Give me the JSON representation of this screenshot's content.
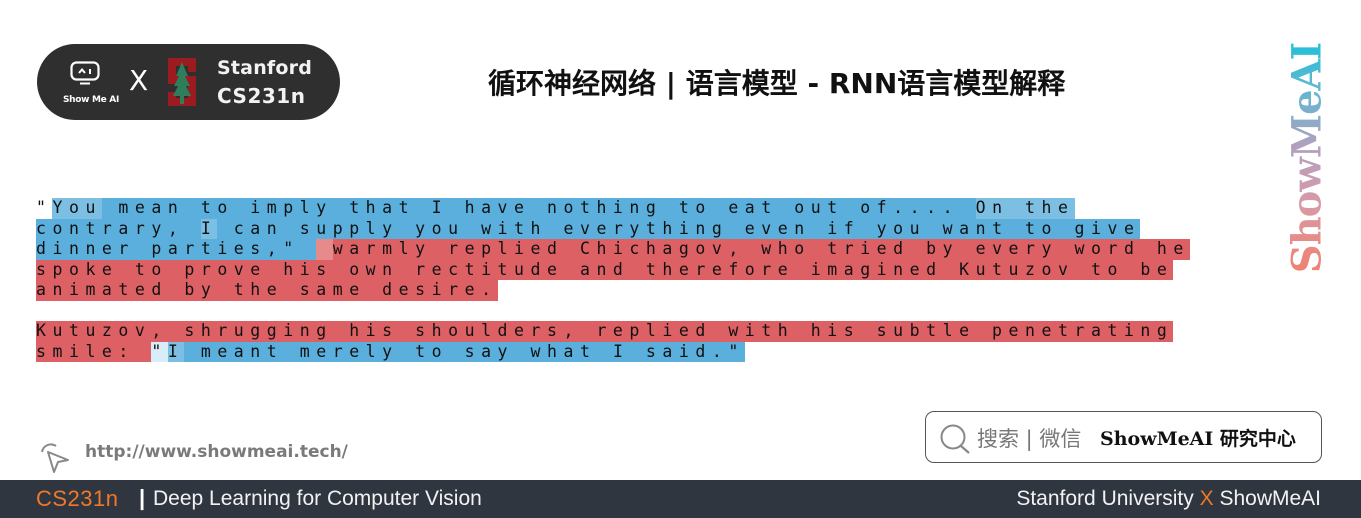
{
  "header": {
    "logo": {
      "showmeai_label": "Show Me AI",
      "cross": "X",
      "stanford_line1": "Stanford",
      "stanford_line2": "CS231n"
    },
    "title": "循环神经网络 | 语言模型 - RNN语言模型解释"
  },
  "watermark": "ShowMeAI",
  "colors": {
    "cell_blue": "#5aafdc",
    "cell_blue_light": "#7cbfe2",
    "cell_blue_pale": "#d8edf8",
    "cell_red": "#dc6064",
    "cell_red_light": "#e68a8c",
    "bottom_bar": "#2f3640",
    "accent_orange": "#f07828"
  },
  "visualization": {
    "lines": [
      [
        {
          "t": "\"",
          "c": "none"
        },
        {
          "t": "You",
          "c": "blue_light"
        },
        {
          "t": " mean to imply that I have nothing to eat out of.... ",
          "c": "blue"
        },
        {
          "t": "On the",
          "c": "blue_light"
        }
      ],
      [
        {
          "t": "contrary, ",
          "c": "blue"
        },
        {
          "t": "I",
          "c": "blue_light"
        },
        {
          "t": " can supply you with everything even if you want to give",
          "c": "blue"
        }
      ],
      [
        {
          "t": "dinner parties,\" ",
          "c": "blue"
        },
        {
          "t": " ",
          "c": "red_light"
        },
        {
          "t": "warmly replied Chichagov, who tried by every word he",
          "c": "red"
        }
      ],
      [
        {
          "t": "spoke to prove his own rectitude and therefore imagined Kutuzov to be",
          "c": "red"
        }
      ],
      [
        {
          "t": "animated by the same desire.",
          "c": "red"
        }
      ],
      [
        {
          "t": "",
          "c": "none"
        }
      ],
      [
        {
          "t": "Kutuzov, shrugging his shoulders, replied with his subtle penetrating",
          "c": "red"
        }
      ],
      [
        {
          "t": "smile: ",
          "c": "red"
        },
        {
          "t": "\"",
          "c": "blue_pale"
        },
        {
          "t": "I",
          "c": "blue_light"
        },
        {
          "t": " meant merely to say what I said.\"",
          "c": "blue"
        }
      ]
    ]
  },
  "footer": {
    "url": "http://www.showmeai.tech/",
    "search_label": "搜索 | 微信",
    "search_brand": "ShowMeAI 研究中心",
    "course": "CS231n",
    "separator": "|",
    "subtitle": "Deep Learning for Computer Vision",
    "right_left": "Stanford University",
    "right_x": "X",
    "right_right": "ShowMeAI"
  }
}
